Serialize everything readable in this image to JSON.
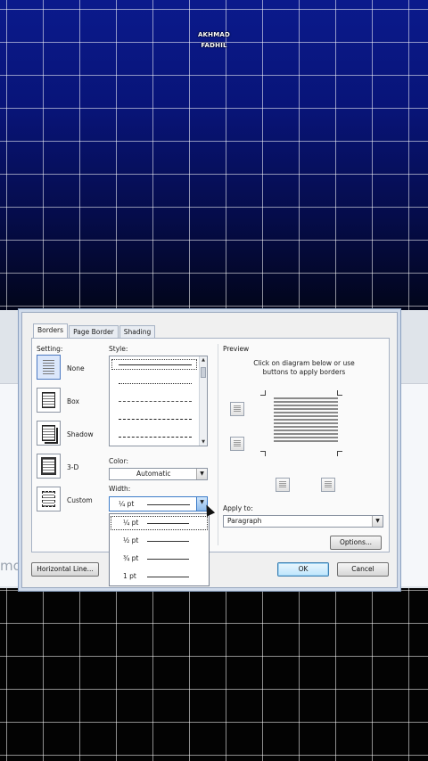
{
  "watermark": "AKHMAD FADHIL",
  "document": {
    "fragment_text": "mo"
  },
  "dialog": {
    "tabs": [
      {
        "label": "Borders",
        "active": true
      },
      {
        "label": "Page Border",
        "active": false
      },
      {
        "label": "Shading",
        "active": false
      }
    ],
    "setting": {
      "label": "Setting:",
      "options": [
        {
          "label": "None",
          "icon": "none-border-icon",
          "selected": true
        },
        {
          "label": "Box",
          "icon": "box-border-icon",
          "selected": false
        },
        {
          "label": "Shadow",
          "icon": "shadow-border-icon",
          "selected": false
        },
        {
          "label": "3-D",
          "icon": "3d-border-icon",
          "selected": false
        },
        {
          "label": "Custom",
          "icon": "custom-border-icon",
          "selected": false
        }
      ]
    },
    "style": {
      "label": "Style:",
      "options": [
        "solid",
        "dotted",
        "dashed-fine",
        "dashed",
        "dash-dot"
      ]
    },
    "color": {
      "label": "Color:",
      "value": "Automatic"
    },
    "width": {
      "label": "Width:",
      "value": "¼ pt",
      "options": [
        "¼ pt",
        "½ pt",
        "¾ pt",
        "1 pt"
      ],
      "highlighted": "¼ pt"
    },
    "preview": {
      "label": "Preview",
      "instructions": "Click on diagram below or use buttons to apply borders"
    },
    "apply_to": {
      "label": "Apply to:",
      "value": "Paragraph"
    },
    "buttons": {
      "options": "Options...",
      "horizontal_line": "Horizontal Line...",
      "ok": "OK",
      "cancel": "Cancel"
    }
  },
  "colors": {
    "accent": "#4a78c2",
    "background_top": "#081478",
    "dialog_bg": "#f0f0f0"
  }
}
